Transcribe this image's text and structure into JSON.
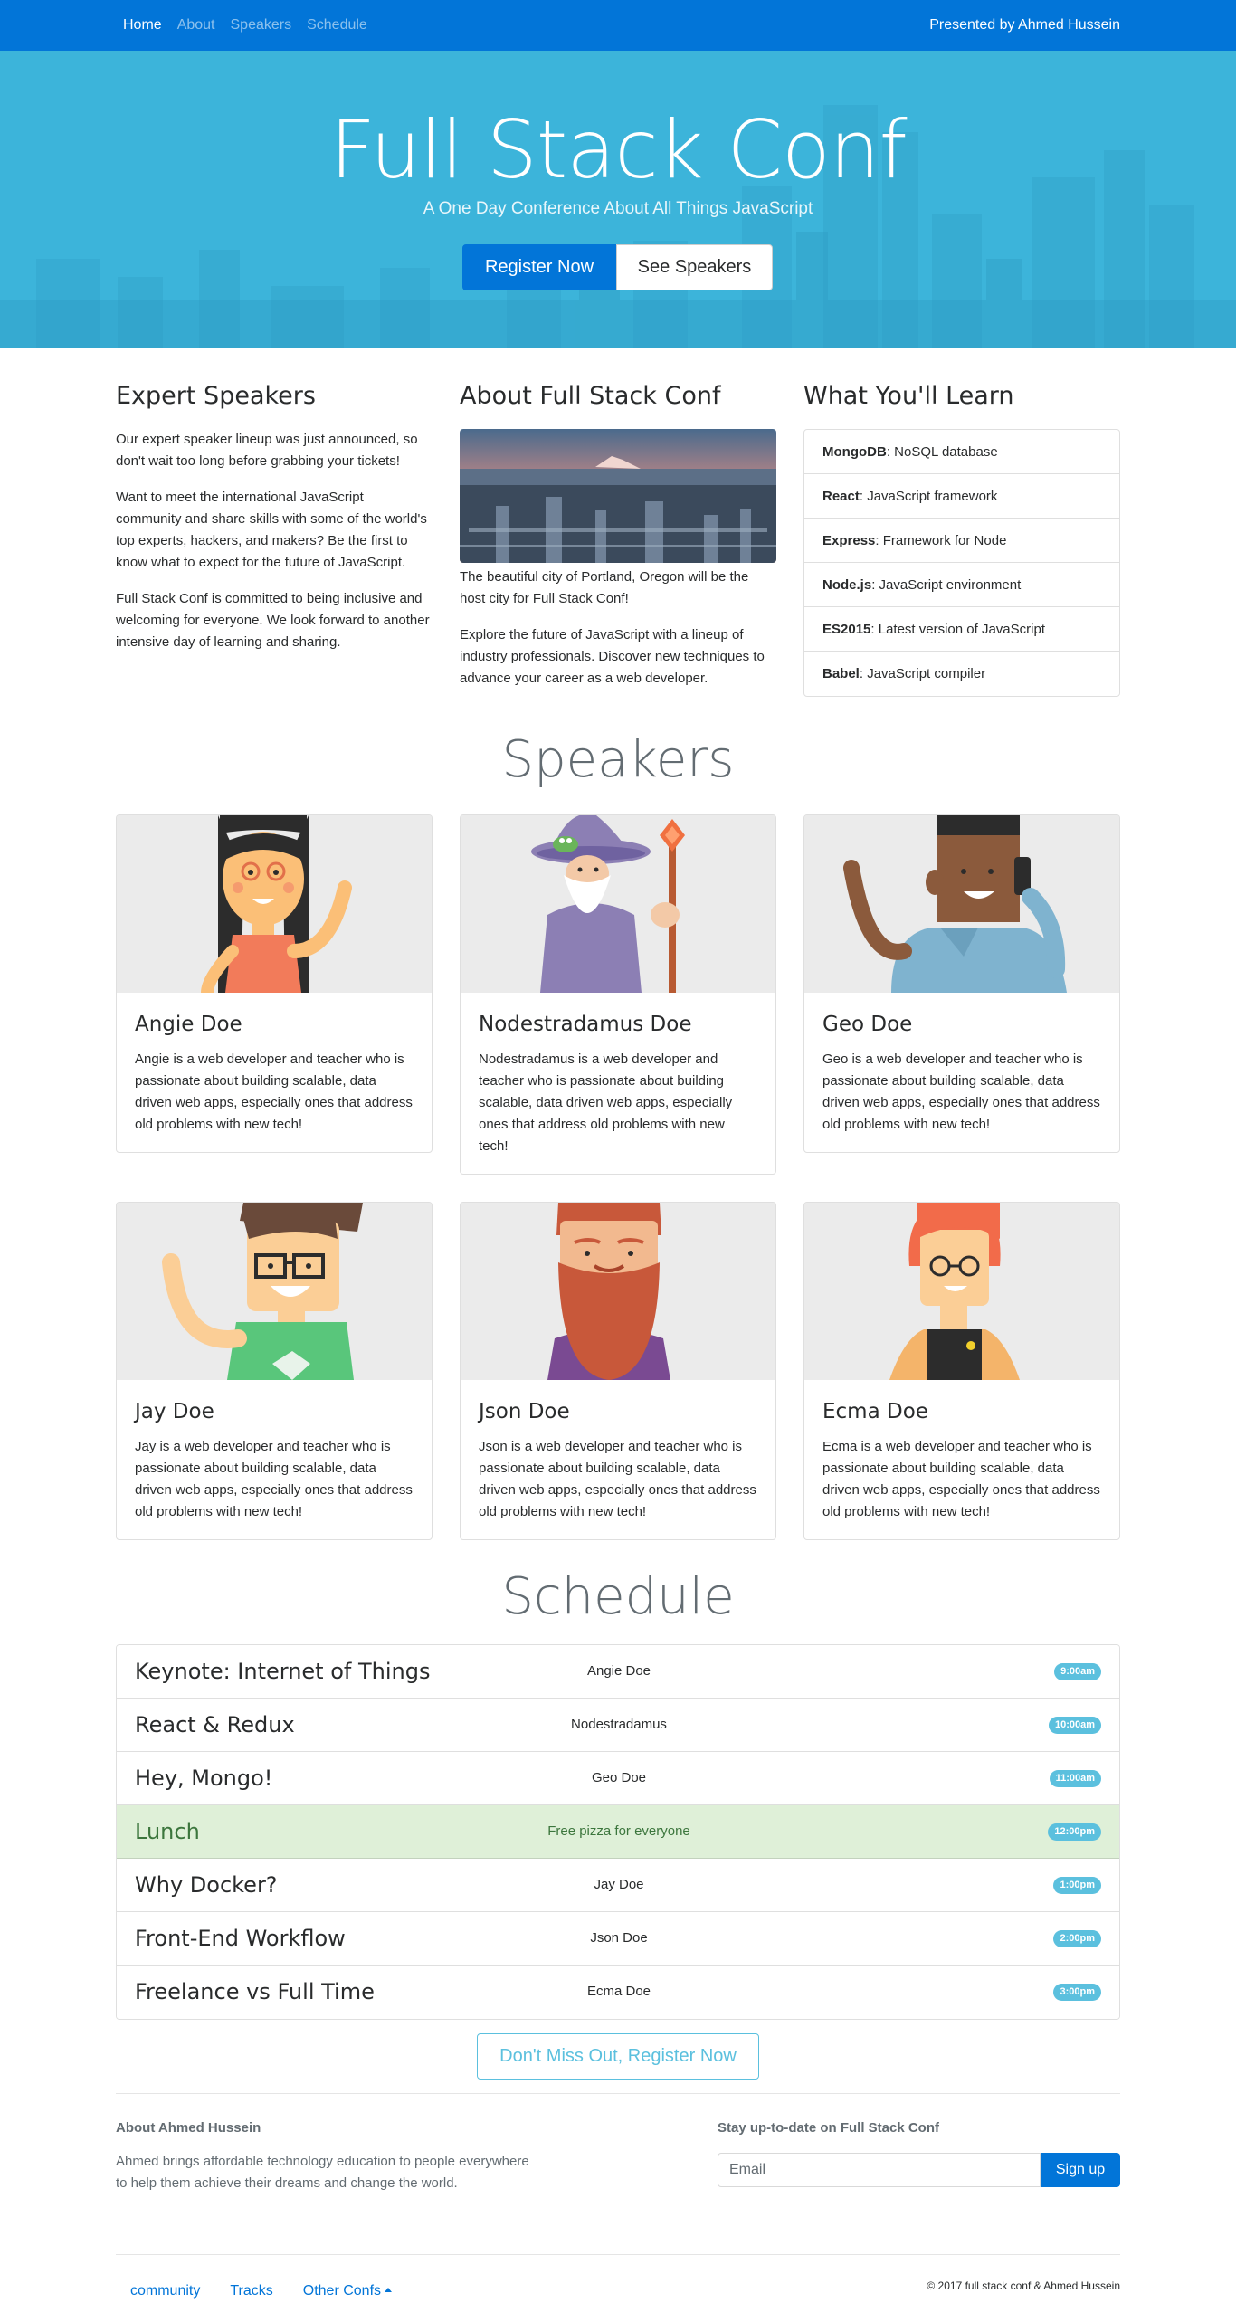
{
  "nav": {
    "links": [
      {
        "label": "Home",
        "active": true
      },
      {
        "label": "About",
        "active": false
      },
      {
        "label": "Speakers",
        "active": false
      },
      {
        "label": "Schedule",
        "active": false
      }
    ],
    "presented_by": "Presented by Ahmed Hussein"
  },
  "hero": {
    "title": "Full Stack Conf",
    "subtitle": "A One Day Conference About All Things JavaScript",
    "register_label": "Register Now",
    "speakers_label": "See Speakers"
  },
  "expert": {
    "title": "Expert Speakers",
    "paragraphs": [
      "Our expert speaker lineup was just announced, so don't wait too long before grabbing your tickets!",
      "Want to meet the international JavaScript community and share skills with some of the world's top experts, hackers, and makers? Be the first to know what to expect for the future of JavaScript.",
      "Full Stack Conf is committed to being inclusive and welcoming for everyone. We look forward to another intensive day of learning and sharing."
    ]
  },
  "about": {
    "title": "About Full Stack Conf",
    "paragraphs": [
      "The beautiful city of Portland, Oregon will be the host city for Full Stack Conf!",
      "Explore the future of JavaScript with a lineup of industry professionals. Discover new techniques to advance your career as a web developer."
    ]
  },
  "learn": {
    "title": "What You'll Learn",
    "items": [
      {
        "name": "MongoDB",
        "desc": ": NoSQL database"
      },
      {
        "name": "React",
        "desc": ": JavaScript framework"
      },
      {
        "name": "Express",
        "desc": ": Framework for Node"
      },
      {
        "name": "Node.js",
        "desc": ": JavaScript environment"
      },
      {
        "name": "ES2015",
        "desc": ": Latest version of JavaScript"
      },
      {
        "name": "Babel",
        "desc": ": JavaScript compiler"
      }
    ]
  },
  "speakers": {
    "title": "Speakers",
    "cards": [
      {
        "name": "Angie Doe",
        "bio": "Angie is a web developer and teacher who is passionate about building scalable, data driven web apps, especially ones that address old problems with new tech!"
      },
      {
        "name": "Nodestradamus Doe",
        "bio": "Nodestradamus is a web developer and teacher who is passionate about building scalable, data driven web apps, especially ones that address old problems with new tech!"
      },
      {
        "name": "Geo Doe",
        "bio": "Geo is a web developer and teacher who is passionate about building scalable, data driven web apps, especially ones that address old problems with new tech!"
      },
      {
        "name": "Jay Doe",
        "bio": "Jay is a web developer and teacher who is passionate about building scalable, data driven web apps, especially ones that address old problems with new tech!"
      },
      {
        "name": "Json Doe",
        "bio": "Json is a web developer and teacher who is passionate about building scalable, data driven web apps, especially ones that address old problems with new tech!"
      },
      {
        "name": "Ecma Doe",
        "bio": "Ecma is a web developer and teacher who is passionate about building scalable, data driven web apps, especially ones that address old problems with new tech!"
      }
    ]
  },
  "schedule": {
    "title": "Schedule",
    "rows": [
      {
        "title": "Keynote: Internet of Things",
        "speaker": "Angie Doe",
        "time": "9:00am"
      },
      {
        "title": "React & Redux",
        "speaker": "Nodestradamus",
        "time": "10:00am"
      },
      {
        "title": "Hey, Mongo!",
        "speaker": "Geo Doe",
        "time": "11:00am"
      },
      {
        "title": "Lunch",
        "speaker": "Free pizza for everyone",
        "time": "12:00pm"
      },
      {
        "title": "Why Docker?",
        "speaker": "Jay Doe",
        "time": "1:00pm"
      },
      {
        "title": "Front-End Workflow",
        "speaker": "Json Doe",
        "time": "2:00pm"
      },
      {
        "title": "Freelance vs Full Time",
        "speaker": "Ecma Doe",
        "time": "3:00pm"
      }
    ],
    "cta_label": "Don't Miss Out, Register Now"
  },
  "footer": {
    "about_title": "About Ahmed Hussein",
    "about_text": "Ahmed brings affordable technology education to people everywhere to help them achieve their dreams and change the world.",
    "subscribe_title": "Stay up-to-date on Full Stack Conf",
    "email_placeholder": "Email",
    "signup_label": "Sign up",
    "links": [
      "community",
      "Tracks",
      "Other Confs"
    ],
    "copyright": "© 2017 full stack conf & Ahmed Hussein"
  },
  "colors": {
    "primary": "#0275d8",
    "hero": "#3cb4da",
    "info": "#5bc0de",
    "success_bg": "#dff0d8"
  }
}
